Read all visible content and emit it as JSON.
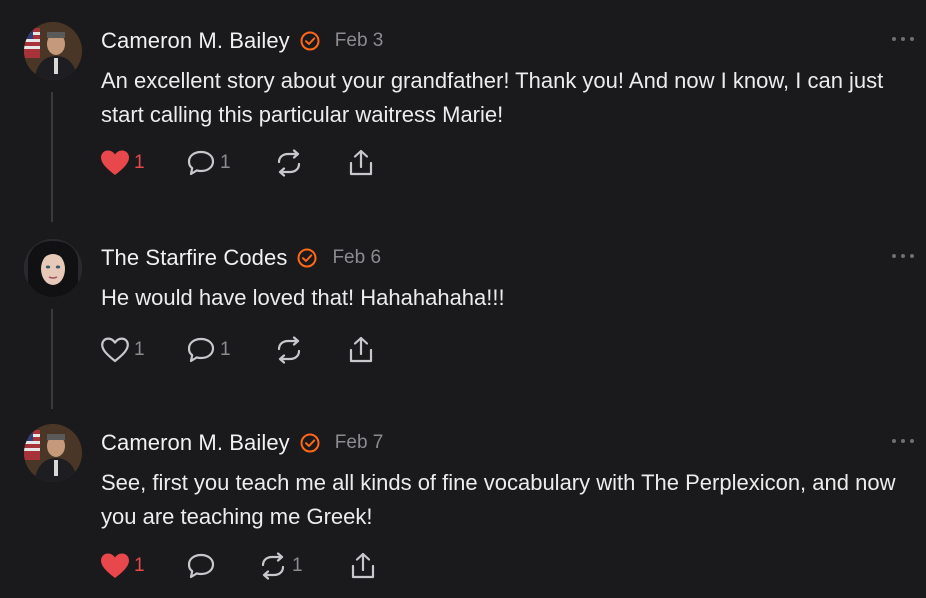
{
  "comments": [
    {
      "author": "Cameron M. Bailey",
      "date": "Feb 3",
      "text": "An excellent story about your grandfather! Thank you! And now I know, I can just start calling this particular waitress Marie!",
      "liked": true,
      "like_count": "1",
      "reply_count": "1",
      "restack_count": "",
      "avatar": "portrait-man-flag"
    },
    {
      "author": "The Starfire Codes",
      "date": "Feb 6",
      "text": "He would have loved that! Hahahahaha!!!",
      "liked": false,
      "like_count": "1",
      "reply_count": "1",
      "restack_count": "",
      "avatar": "portrait-woman-dark-hair"
    },
    {
      "author": "Cameron M. Bailey",
      "date": "Feb 7",
      "text": "See, first you teach me all kinds of fine vocabulary with The Perplexicon, and now you are teaching me Greek!",
      "liked": true,
      "like_count": "1",
      "reply_count": "",
      "restack_count": "1",
      "avatar": "portrait-man-flag"
    }
  ],
  "colors": {
    "background": "#1a1a1c",
    "verified_badge": "#ff6719",
    "like_active": "#e8474c",
    "muted_text": "#8c8c90"
  },
  "icons": [
    "verified-badge-icon",
    "heart-icon",
    "comment-icon",
    "restack-icon",
    "share-icon",
    "more-options-icon"
  ]
}
